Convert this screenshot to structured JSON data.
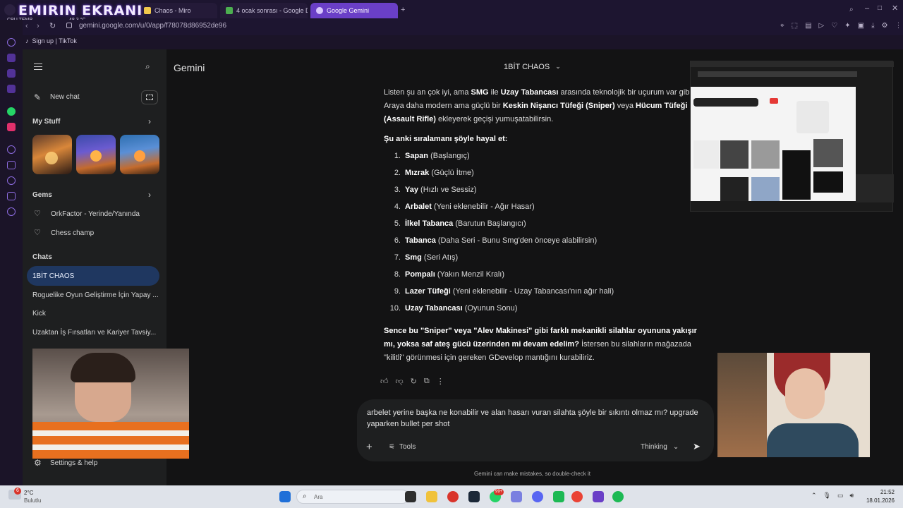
{
  "overlay": {
    "streamer_title": "EMIRIN EKRANI",
    "cpu_label": "CPU TEMP",
    "cpu_value": "48.3 °C"
  },
  "browser": {
    "tabs": [
      {
        "label": "Chaos - Miro"
      },
      {
        "label": "4 ocak sonrası - Google D"
      },
      {
        "label": "Google Gemini",
        "active": true
      }
    ],
    "url": "gemini.google.com/u/0/app/f78078d86952de96",
    "bookmark": "Sign up | TikTok"
  },
  "sidebar": {
    "app_name": "Gemini",
    "new_chat": "New chat",
    "my_stuff": "My Stuff",
    "gems_title": "Gems",
    "gems": [
      "OrkFactor - Yerinde/Yanında",
      "Chess champ"
    ],
    "chats_title": "Chats",
    "chats": [
      "1BİT CHAOS",
      "Roguelike Oyun Geliştirme İçin Yapay ...",
      "Kick",
      "Uzaktan İş Fırsatları ve Kariyer Tavsiy..."
    ],
    "settings": "Settings & help"
  },
  "header": {
    "conversation_title": "1BİT CHAOS"
  },
  "response": {
    "intro_parts": [
      "Listen şu an çok iyi, ama ",
      "SMG",
      " ile ",
      "Uzay Tabancası",
      " arasında teknolojik bir uçurum var gibi. Araya daha modern ama güçlü bir ",
      "Keskin Nişancı Tüfeği (Sniper)",
      " veya ",
      "Hücum Tüfeği (Assault Rifle)",
      " ekleyerek geçişi yumuşatabilirsin."
    ],
    "list_heading": "Şu anki sıralamanı şöyle hayal et:",
    "list": [
      {
        "num": "1.",
        "name": "Sapan",
        "desc": "(Başlangıç)"
      },
      {
        "num": "2.",
        "name": "Mızrak",
        "desc": "(Güçlü İtme)"
      },
      {
        "num": "3.",
        "name": "Yay",
        "desc": "(Hızlı ve Sessiz)"
      },
      {
        "num": "4.",
        "name": "Arbalet",
        "desc": "(Yeni eklenebilir - Ağır Hasar)"
      },
      {
        "num": "5.",
        "name": "İlkel Tabanca",
        "desc": "(Barutun Başlangıcı)"
      },
      {
        "num": "6.",
        "name": "Tabanca",
        "desc": "(Daha Seri - Bunu Smg'den önceye alabilirsin)"
      },
      {
        "num": "7.",
        "name": "Smg",
        "desc": "(Seri Atış)"
      },
      {
        "num": "8.",
        "name": "Pompalı",
        "desc": "(Yakın Menzil Kralı)"
      },
      {
        "num": "9.",
        "name": "Lazer Tüfeği",
        "desc": "(Yeni eklenebilir - Uzay Tabancası'nın ağır hali)"
      },
      {
        "num": "10.",
        "name": "Uzay Tabancası",
        "desc": "(Oyunun Sonu)"
      }
    ],
    "closing_bold": "Sence bu \"Sniper\" veya \"Alev Makinesi\" gibi farklı mekanikli silahlar oyununa yakışır mı, yoksa saf ateş gücü üzerinden mi devam edelim?",
    "closing_rest": " İstersen bu silahların mağazada \"kilitli\" görünmesi için gereken GDevelop mantığını kurabiliriz."
  },
  "input": {
    "text": "arbelet yerine başka ne konabilir ve alan hasarı vuran silahta şöyle bir sıkıntı olmaz mı? upgrade yaparken bullet per shot",
    "tools_label": "Tools",
    "mode_label": "Thinking",
    "disclaimer": "Gemini can make mistakes, so double-check it"
  },
  "taskbar": {
    "weather_temp": "2°C",
    "weather_desc": "Bulutlu",
    "weather_badge": "6",
    "search_placeholder": "Ara",
    "time": "21:52",
    "date": "18.01.2026",
    "notif_badge": "99+"
  },
  "colors": {
    "accent_purple": "#6a3fc7",
    "active_chat": "#1f3760"
  }
}
